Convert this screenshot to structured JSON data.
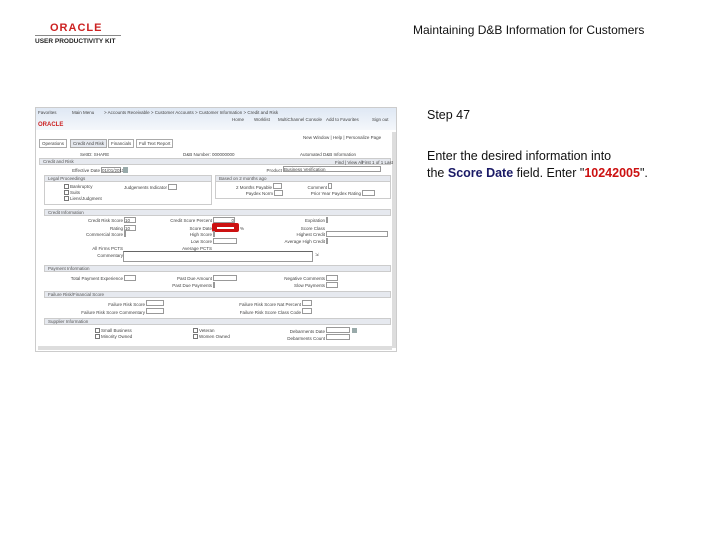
{
  "header": {
    "logo_brand": "ORACLE",
    "logo_sub": "USER PRODUCTIVITY KIT",
    "title": "Maintaining D&B Information for Customers"
  },
  "instructions": {
    "step": "Step 47",
    "line1": "Enter the desired information into",
    "line2_pre": "the ",
    "field": "Score Date",
    "line2_mid": " field. Enter \"",
    "value": "10242005",
    "line2_post": "\"."
  },
  "app": {
    "nav": [
      "Favorites",
      "Main Menu",
      "> Accounts Receivable > Customer Accounts > Customer Information > Credit and Risk"
    ],
    "links": [
      "Home",
      "Worklist",
      "MultiChannel Console",
      "Add to Favorites",
      "Sign out"
    ],
    "brand": "ORACLE",
    "page_links": "New Window | Help | Personalize Page",
    "tabs": [
      "Operations",
      "Credit And Risk",
      "Financials",
      "Full Text Report"
    ],
    "setid": "SetID: SHARE",
    "duns": "D&B Number: 000000000",
    "automated": "Automated D&B Information",
    "credit_risk": "Credit and Risk",
    "find": "Find | View All",
    "first": "First 1 of 1 Last",
    "eff_date_label": "Effective Date",
    "eff_date": "01/01/2011",
    "product_label": "Product",
    "product": "Business Verification",
    "legal": {
      "title": "Legal Proceedings",
      "items": [
        "Bankruptcy",
        "Suits",
        "Liens/Judgment"
      ],
      "judgement": "Judgements Indicator"
    },
    "paydex": {
      "title": "Based on 2 months ago",
      "two_months": "2 Months Payable",
      "comment": "Comment",
      "norm": "Paydex Norm",
      "prior": "Prior Year Paydex Rating"
    },
    "credit": {
      "title": "Credit Information",
      "cred_score": "Credit Risk Score",
      "cred_score_val": "10",
      "pct": "Credit Score Percent",
      "pct_val": "0",
      "expiration": "Expiration",
      "rating": "Rating",
      "rating_val": "10",
      "score_date": "Score Date",
      "score_class": "Score Class",
      "commercial": "Commercial Score",
      "high": "High Score",
      "highest": "Highest Credit",
      "low": "Low Score",
      "avg": "Average High Credit",
      "all_firms": "All Firms PCTS",
      "average": "Average PCTS",
      "commentary": "Commentary"
    },
    "payment": {
      "title": "Payment Information",
      "total": "Total Payment Experience",
      "past_due_amt": "Past Due Amount",
      "past_due_pay": "Past Due Payments",
      "negative": "Negative Comments",
      "slow": "Slow Payments"
    },
    "failure": {
      "title": "Failure Risk/Financial Score",
      "score": "Failure Risk Score",
      "commentary": "Failure Risk Score Commentary",
      "national": "Failure Risk Score Nat Percent",
      "class": "Failure Risk Score Class Code"
    },
    "supplier": {
      "title": "Supplier Information",
      "items": [
        "Small Business",
        "Minority Owned",
        "Veteran",
        "Women Owned"
      ],
      "deb_date": "Debarments Date",
      "deb_count": "Debarments Count"
    }
  },
  "colors": {
    "highlight": "#cc1111",
    "field": "#1a1a66",
    "brand": "#cc2222"
  }
}
